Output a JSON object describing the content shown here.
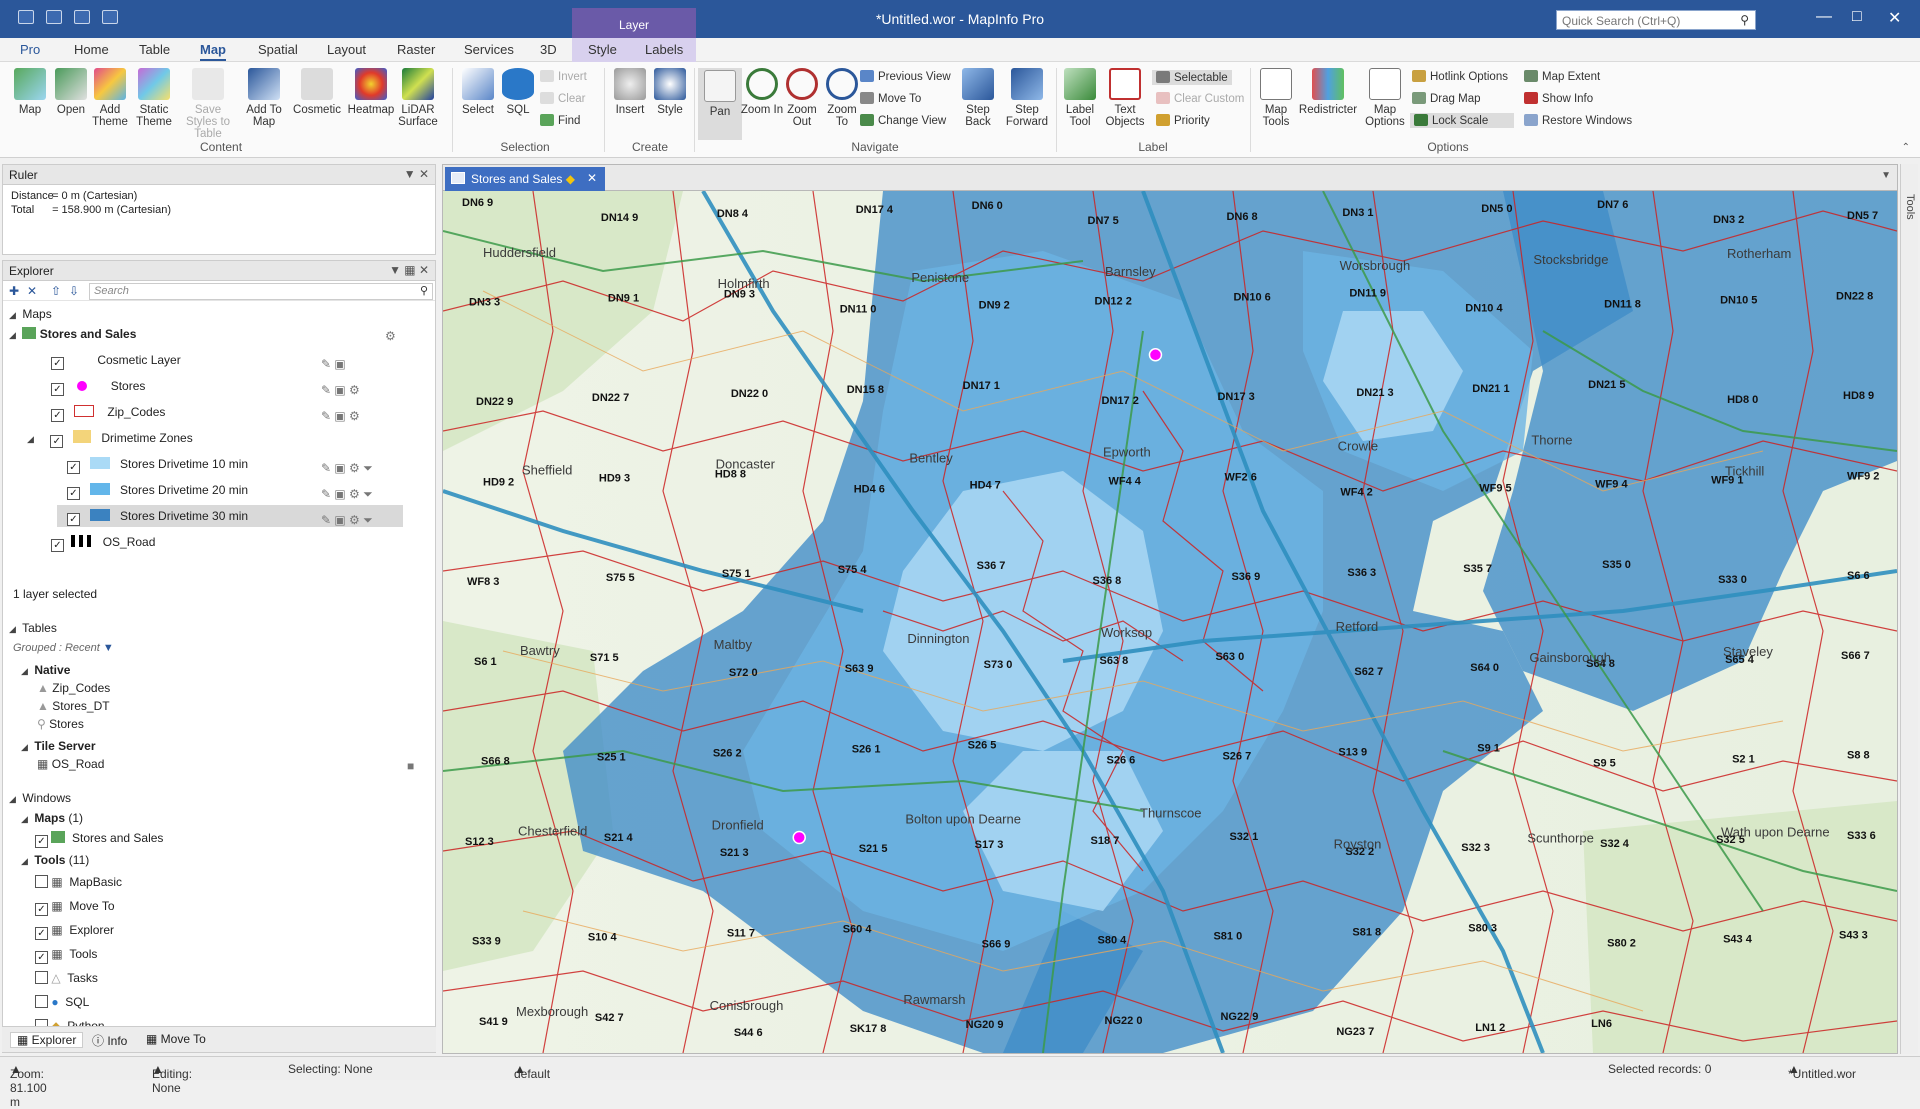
{
  "title": "*Untitled.wor - MapInfo Pro",
  "context_group": "Layer",
  "quick_search": "Quick Search (Ctrl+Q)",
  "tabs": [
    "Pro",
    "Home",
    "Table",
    "Map",
    "Spatial",
    "Layout",
    "Raster",
    "Services",
    "3D",
    "Style",
    "Labels"
  ],
  "active_tab": "Map",
  "ribbon": {
    "content": {
      "label": "Content",
      "buttons": [
        "Map",
        "Open",
        "Add Theme",
        "Static Theme",
        "Save Styles to Table",
        "Add To Map",
        "Cosmetic",
        "Heatmap",
        "LiDAR Surface"
      ]
    },
    "selection": {
      "label": "Selection",
      "buttons": [
        "Select",
        "SQL"
      ],
      "small": [
        "Invert",
        "Clear",
        "Find"
      ]
    },
    "create": {
      "label": "Create",
      "buttons": [
        "Insert",
        "Style"
      ]
    },
    "navigate": {
      "label": "Navigate",
      "buttons": [
        "Pan",
        "Zoom In",
        "Zoom Out",
        "Zoom To",
        "Step Back",
        "Step Forward"
      ],
      "small": [
        "Previous View",
        "Move To",
        "Change View"
      ]
    },
    "label": {
      "label": "Label",
      "buttons": [
        "Label Tool",
        "Text Objects"
      ],
      "small": [
        "Selectable",
        "Clear Custom",
        "Priority"
      ]
    },
    "options": {
      "label": "Options",
      "buttons": [
        "Map Tools",
        "Redistricter",
        "Map Options"
      ],
      "small": [
        "Hotlink Options",
        "Drag Map",
        "Lock Scale",
        "Map Extent",
        "Show Info",
        "Restore Windows"
      ]
    }
  },
  "ruler": {
    "title": "Ruler",
    "distance_label": "Distance",
    "distance_value": "= 0 m (Cartesian)",
    "total_label": "Total",
    "total_value": "= 158.900 m (Cartesian)"
  },
  "explorer": {
    "title": "Explorer",
    "search_placeholder": "Search",
    "maps_header": "Maps",
    "map_name": "Stores and Sales",
    "layers": [
      "Cosmetic Layer",
      "Stores",
      "Zip_Codes",
      "Drimetime Zones",
      "Stores Drivetime 10 min",
      "Stores Drivetime 20 min",
      "Stores Drivetime 30 min",
      "OS_Road"
    ],
    "selected_count": "1 layer selected",
    "tables_header": "Tables",
    "grouped": "Grouped : Recent",
    "native_header": "Native",
    "native_tables": [
      "Zip_Codes",
      "Stores_DT",
      "Stores"
    ],
    "tile_header": "Tile Server",
    "tile_tables": [
      "OS_Road"
    ],
    "windows_header": "Windows",
    "maps_group": "Maps",
    "maps_count": "(1)",
    "map_window": "Stores and Sales",
    "tools_group": "Tools",
    "tools_count": "(11)",
    "tools": [
      "MapBasic",
      "Move To",
      "Explorer",
      "Tools",
      "Tasks",
      "SQL",
      "Python"
    ]
  },
  "bottom_tabs": [
    "Explorer",
    "Info",
    "Move To"
  ],
  "map_window": {
    "tab_title": "Stores and Sales",
    "right_tools": "Tools",
    "labels": [
      "DN6 9",
      "DN14 9",
      "DN8 4",
      "DN17 4",
      "DN6 0",
      "DN7 5",
      "DN6 8",
      "DN3 1",
      "DN5 0",
      "DN7 6",
      "DN3 2",
      "DN5 7",
      "DN3 3",
      "DN9 1",
      "DN9 3",
      "DN11 0",
      "DN9 2",
      "DN12 2",
      "DN10 6",
      "DN11 9",
      "DN10 4",
      "DN11 8",
      "DN10 5",
      "DN22 8",
      "DN22 9",
      "DN22 7",
      "DN22 0",
      "DN15 8",
      "DN17 1",
      "DN17 2",
      "DN17 3",
      "DN21 3",
      "DN21 1",
      "DN21 5",
      "HD8 0",
      "HD8 9",
      "HD9 2",
      "HD9 3",
      "HD8 8",
      "HD4 6",
      "HD4 7",
      "WF4 4",
      "WF2 6",
      "WF4 2",
      "WF9 5",
      "WF9 4",
      "WF9 1",
      "WF9 2",
      "WF8 3",
      "S75 5",
      "S75 1",
      "S75 4",
      "S36 7",
      "S36 8",
      "S36 9",
      "S36 3",
      "S35 7",
      "S35 0",
      "S33 0",
      "S6 6",
      "S6 1",
      "S71 5",
      "S72 0",
      "S63 9",
      "S73 0",
      "S63 8",
      "S63 0",
      "S62 7",
      "S64 0",
      "S64 8",
      "S65 4",
      "S66 7",
      "S66 8",
      "S25 1",
      "S26 2",
      "S26 1",
      "S26 5",
      "S26 6",
      "S26 7",
      "S13 9",
      "S9 1",
      "S9 5",
      "S2 1",
      "S8 8",
      "S12 3",
      "S21 4",
      "S21 3",
      "S21 5",
      "S17 3",
      "S18 7",
      "S32 1",
      "S32 2",
      "S32 3",
      "S32 4",
      "S32 5",
      "S33 6",
      "S33 9",
      "S10 4",
      "S11 7",
      "S60 4",
      "S66 9",
      "S80 4",
      "S81 0",
      "S81 8",
      "S80 3",
      "S80 2",
      "S43 4",
      "S43 3",
      "S41 9",
      "S42 7",
      "S44 6",
      "SK17 8",
      "NG20 9",
      "NG22 0",
      "NG22 9",
      "NG23 7",
      "LN1 2",
      "LN6"
    ],
    "places": [
      "Huddersfield",
      "Holmfirth",
      "Penistone",
      "Barnsley",
      "Worsbrough",
      "Stocksbridge",
      "Rotherham",
      "Sheffield",
      "Doncaster",
      "Bentley",
      "Epworth",
      "Crowle",
      "Thorne",
      "Tickhill",
      "Bawtry",
      "Maltby",
      "Dinnington",
      "Worksop",
      "Retford",
      "Gainsborough",
      "Staveley",
      "Chesterfield",
      "Dronfield",
      "Bolton upon Dearne",
      "Thurnscoe",
      "Royston",
      "Scunthorpe",
      "Wath upon Dearne",
      "Mexborough",
      "Conisbrough",
      "Rawmarsh"
    ]
  },
  "status": {
    "zoom": "Zoom: 81.100 m",
    "editing": "Editing: None",
    "selecting": "Selecting: None",
    "style": "default",
    "records": "Selected records: 0",
    "workspace": "*Untitled.wor"
  }
}
